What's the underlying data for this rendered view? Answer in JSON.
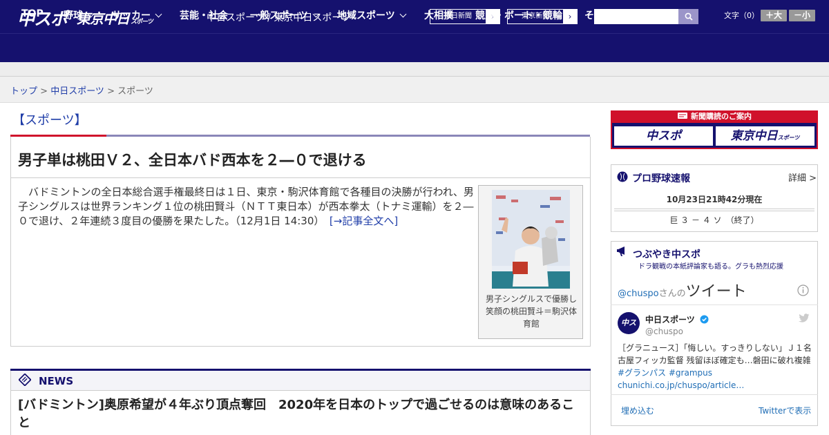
{
  "header": {
    "logo_chuspo": "中スポ",
    "logo_tokyo": "東京中日",
    "logo_tokyo_sub": "スポーツ",
    "site_name": "中日スポーツ / 東京中日スポーツ",
    "chunichi_link": "中日新聞",
    "tokyo_link": "東京新聞",
    "font_size_label": "文字（0）",
    "font_larger": "＋大",
    "font_smaller": "－小"
  },
  "nav": {
    "items": [
      "TOP",
      "野球",
      "サッカー",
      "芸能・社会",
      "一般スポーツ",
      "地域スポーツ",
      "大相撲",
      "競馬・ボート・競輪",
      "その他"
    ]
  },
  "breadcrumb": {
    "top": "トップ",
    "sep1": " > ",
    "chunichi_sports": "中日スポーツ",
    "sep2": " > ",
    "current": "スポーツ"
  },
  "article": {
    "section": "【スポーツ】",
    "headline": "男子単は桃田Ｖ２、全日本バド西本を２―０で退ける",
    "lead": "　バドミントンの全日本総合選手権最終日は１日、東京・駒沢体育館で各種目の決勝が行われ、男子シングルスは世界ランキング１位の桃田賢斗（ＮＴＴ東日本）が西本拳太（トナミ運輸）を２―０で退け、２年連続３度目の優勝を果たした。（12月1日 14:30）",
    "more": "[→記事全文へ]",
    "caption": "男子シングルスで優勝し笑顔の桃田賢斗＝駒沢体育館"
  },
  "news": {
    "label": "NEWS",
    "title": "[バドミントン]奥原希望が４年ぶり頂点奪回　2020年を日本のトップで過ごせるのは意味のあること"
  },
  "sidebar": {
    "ad_title": "新聞購読のご案内",
    "ad_chuspo": "中スポ",
    "ad_tokyo": "東京中日",
    "ad_tokyo_sub": "スポーツ",
    "baseball_title": "プロ野球速報",
    "baseball_detail": "詳細 >",
    "baseball_time": "10月23日21時42分現在",
    "baseball_score": "巨 ３ － ４ ソ　（終了）",
    "tweet_title": "つぶやき中スポ",
    "tweet_sub": "ドラ観戦の本紙評論家も語る。グラも熱烈応援",
    "tweet_account": "@chuspo",
    "tweet_san": "さんの",
    "tweet_word": "ツイート",
    "tweet_name": "中日スポーツ",
    "tweet_handle": "@chuspo",
    "tweet_body": "［グラニュース］「悔しい。すっきりしない」Ｊ１名古屋フィッカ監督 残留ほぼ確定も…磐田に破れ複雑",
    "tweet_hash": "#グランパス #grampus",
    "tweet_link": "chunichi.co.jp/chuspo/article…",
    "tweet_avatar": "中スポ",
    "tweet_embed": "埋め込む",
    "tweet_view": "Twitterで表示"
  },
  "colors": {
    "brand_navy": "#15116e",
    "accent_red": "#d0112b",
    "link_blue": "#1f3da8"
  }
}
